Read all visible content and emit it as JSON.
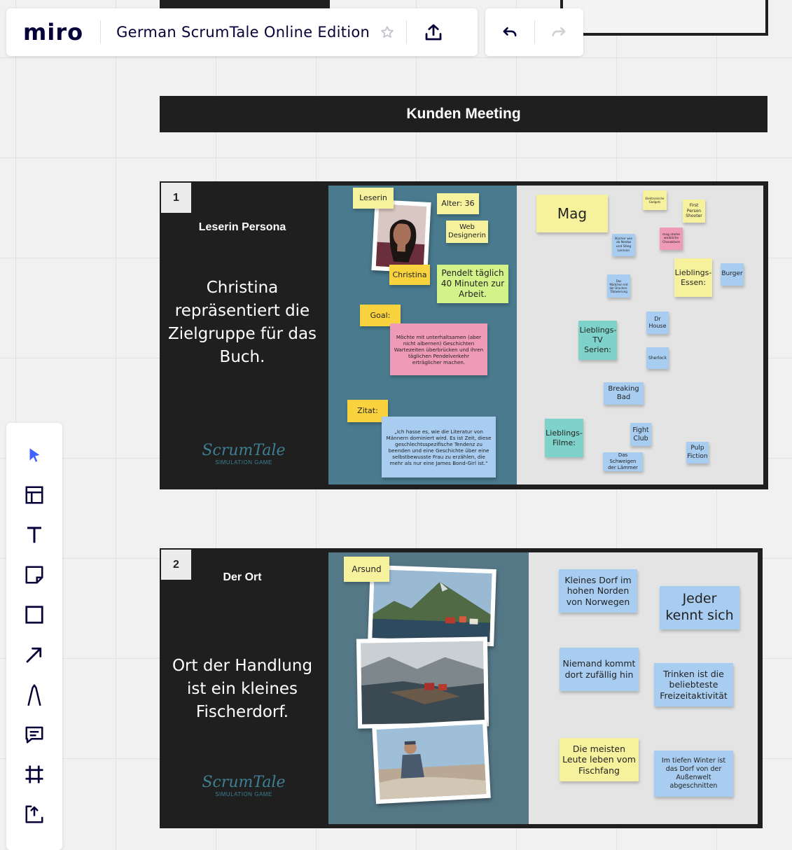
{
  "app": {
    "logo": "miro",
    "board_title": "German ScrumTale Online Edition"
  },
  "banner": {
    "title": "Kunden Meeting"
  },
  "frame1": {
    "number": "1",
    "title": "Leserin Persona",
    "description": "Christina repräsentiert die Zielgruppe für das Buch.",
    "brand": {
      "name": "ScrumTale",
      "sub": "SIMULATION GAME"
    },
    "persona_notes": {
      "leserin": "Leserin",
      "alter": "Alter: 36",
      "beruf": "Web Designerin",
      "name": "Christina",
      "pendelt": "Pendelt täglich 40 Minuten zur Arbeit.",
      "goal_label": "Goal:",
      "goal_text": "Möchte mit unterhaltsamen (aber nicht albernen) Geschichten Wartezeiten überbrücken und ihren täglichen Pendelverkehr erträglicher machen.",
      "zitat_label": "Zitat:",
      "zitat_text": "„Ich hasse es, wie die Literatur von Männern dominiert wird. Es ist Zeit, diese geschlechtsspezifische Tendenz zu beenden und eine Geschichte über eine selbstbewusste Frau zu erzählen, die mehr als nur eine James Bond-Girl ist.\""
    },
    "likes_notes": {
      "mag": "Mag",
      "gadgets": "Elektronische Gadgets",
      "shooter": "First Person Shooter",
      "buecher": "Bücher wie zb Nesbø und Stieg Larsson",
      "charaktere": "mag starke weibliche Charaktere",
      "essen_label": "Lieblings-Essen:",
      "burger": "Burger",
      "maedchen": "Das Mädchen mit der Drachen-Tätowierung",
      "tv_label": "Lieblings-TV Serien:",
      "dr_house": "Dr House",
      "sherlock": "Sherlock",
      "breaking_bad": "Breaking Bad",
      "filme_label": "Lieblings-Filme:",
      "fight_club": "Fight Club",
      "schweigen": "Das Schweigen der Lämmer",
      "pulp": "Pulp Fiction"
    }
  },
  "frame2": {
    "number": "2",
    "title": "Der Ort",
    "description": "Ort der Handlung ist ein kleines Fischerdorf.",
    "brand": {
      "name": "ScrumTale",
      "sub": "SIMULATION GAME"
    },
    "place_label": "Arsund",
    "notes": {
      "dorf": "Kleines Dorf im hohen Norden von Norwegen",
      "jeder": "Jeder kennt sich",
      "niemand": "Niemand kommt dort zufällig hin",
      "trinken": "Trinken ist die beliebteste Freizeitaktivität",
      "leute": "Die meisten Leute leben vom Fischfang",
      "winter": "Im tiefen Winter ist das Dorf von der Außenwelt abgeschnitten"
    }
  },
  "colors": {
    "accent": "#4262ff",
    "dark": "#1f1f1f",
    "teal_panel": "#497a8d",
    "grey_panel": "#e4e4e4",
    "sticky_yellow": "#f6f19c",
    "sticky_orange": "#f9d33e",
    "sticky_green": "#d3f28a",
    "sticky_pink": "#ef9bb8",
    "sticky_blue": "#a8cdf1",
    "sticky_cyan": "#7fd2c9"
  },
  "icons": [
    "star-icon",
    "upload-icon",
    "undo-icon",
    "redo-icon",
    "select-icon",
    "templates-icon",
    "text-icon",
    "sticky-note-icon",
    "shape-icon",
    "arrow-icon",
    "pen-icon",
    "comment-icon",
    "frame-icon",
    "upload-tool-icon"
  ]
}
